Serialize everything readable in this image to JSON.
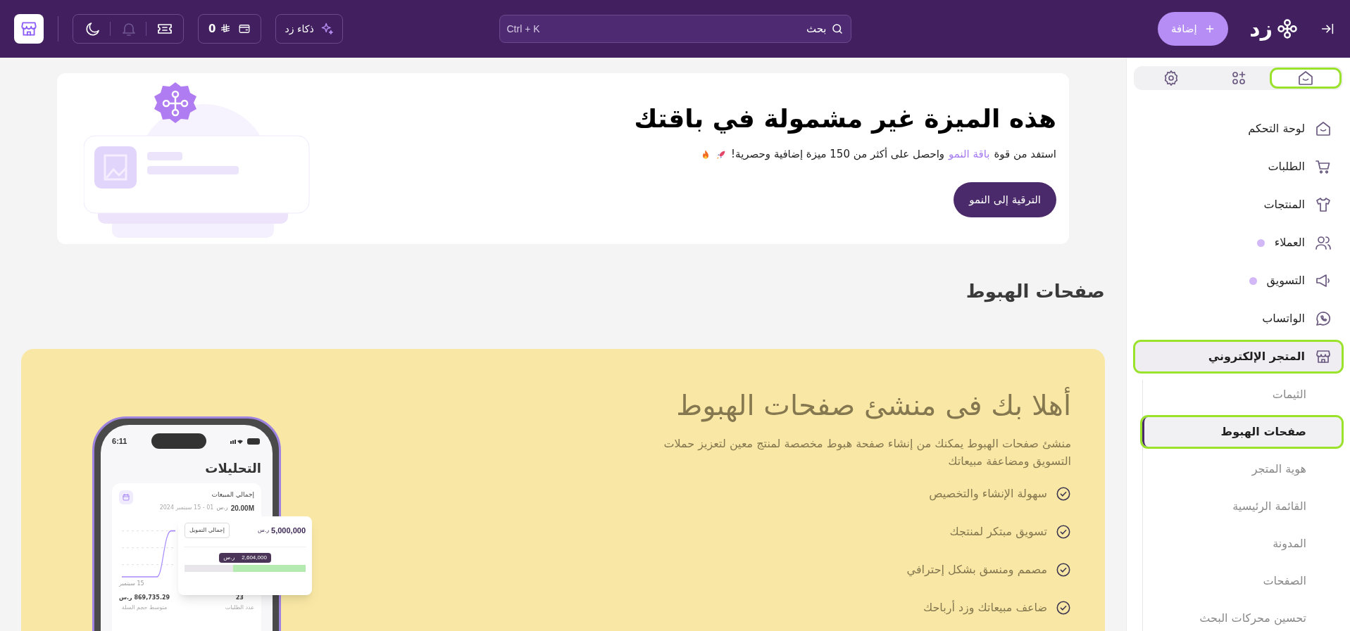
{
  "top_bar": {
    "logo": "زد",
    "add_button": "إضافة",
    "search": {
      "placeholder": "بحث",
      "shortcut": "Ctrl + K"
    },
    "ai_button": "ذكاء زد",
    "wallet": {
      "amount": "0"
    },
    "notifications": {
      "disabled": true
    }
  },
  "sidebar": {
    "tabs": [
      {
        "kind": "home",
        "selected": true,
        "highlighted": true
      },
      {
        "kind": "apps",
        "selected": false,
        "highlighted": false
      },
      {
        "kind": "settings",
        "selected": false,
        "highlighted": false
      }
    ],
    "items": [
      {
        "label": "لوحة التحكم",
        "kind": "home",
        "dot": false,
        "selected": false,
        "highlighted": false
      },
      {
        "label": "الطلبات",
        "kind": "cart",
        "dot": false,
        "selected": false,
        "highlighted": false
      },
      {
        "label": "المنتجات",
        "kind": "shirt",
        "dot": false,
        "selected": false,
        "highlighted": false
      },
      {
        "label": "العملاء",
        "kind": "users",
        "dot": true,
        "selected": false,
        "highlighted": false
      },
      {
        "label": "التسويق",
        "kind": "megaphone",
        "dot": true,
        "selected": false,
        "highlighted": false
      },
      {
        "label": "الواتساب",
        "kind": "whatsapp",
        "dot": false,
        "selected": false,
        "highlighted": false
      },
      {
        "label": "المتجر الإلكتروني",
        "kind": "store",
        "dot": false,
        "selected": true,
        "highlighted": true,
        "expanded": true,
        "children": [
          {
            "label": "الثيمات",
            "selected": false,
            "highlighted": false
          },
          {
            "label": "صفحات الهبوط",
            "selected": true,
            "highlighted": true
          },
          {
            "label": "هوية المتجر",
            "selected": false,
            "highlighted": false
          },
          {
            "label": "القائمة الرئيسية",
            "selected": false,
            "highlighted": false
          },
          {
            "label": "المدونة",
            "selected": false,
            "highlighted": false
          },
          {
            "label": "الصفحات",
            "selected": false,
            "highlighted": false
          },
          {
            "label": "تحسين محركات البحث",
            "selected": false,
            "highlighted": false
          }
        ]
      }
    ]
  },
  "banner": {
    "title": "هذه الميزة غير مشمولة في باقتك",
    "text_before": "استفد من قوة",
    "link": "باقة النمو",
    "text_after": "واحصل على أكثر من 150 ميزة إضافية وحصرية!",
    "button": "الترقية إلى النمو"
  },
  "section_title": "صفحات الهبوط",
  "hero": {
    "title": "أهلا بك فى منشئ صفحات الهبوط",
    "description": "منشئ صفحات الهبوط يمكنك من إنشاء صفحة هبوط مخصصة لمنتج معين لتعزيز حملات التسويق ومضاعفة مبيعاتك",
    "features": [
      "سهولة الإنشاء والتخصيص",
      "تسويق مبتكر لمنتجك",
      "مصمم ومنسق بشكل إحترافي",
      "ضاعف مبيعاتك وزد أرباحك"
    ],
    "phone": {
      "time": "6:11",
      "screen_title": "التحليلات",
      "card_title": "إجمالي المبيعات",
      "card_value": "20.00M",
      "card_currency": "ر.س",
      "date_range": "01 - 15 سبتمبر 2024",
      "axis_label": "15 سبتمبر",
      "stats": [
        {
          "value": "23",
          "label": "عدد الطلبات"
        },
        {
          "value": "869,735.29 ر.س",
          "label": "متوسط حجم السلة"
        }
      ]
    },
    "popup": {
      "amount": "5,000,000",
      "currency": "ر.س",
      "dropdown": "إجمالي التمويل",
      "tooltip_value": "2,604,000",
      "tooltip_currency": "ر.س",
      "level": 0.6
    }
  }
}
